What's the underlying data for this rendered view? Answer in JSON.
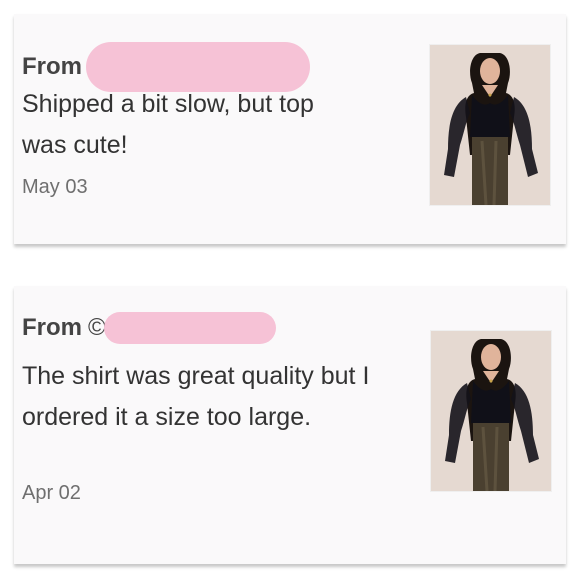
{
  "reviews": [
    {
      "from_label": "From",
      "text": "Shipped a bit slow, but top was cute!",
      "date": "May 03"
    },
    {
      "from_label": "From",
      "handle_prefix": "©",
      "text": "The shirt was great quality but I ordered it a size too large.",
      "date": "Apr 02"
    }
  ],
  "colors": {
    "redaction": "#f6c2d6",
    "card_bg": "#faf9fa",
    "label_text": "#444444",
    "body_text": "#333333",
    "date_text": "#6f6f6f"
  },
  "icons": {
    "product_image": "product-photo-model-black-top"
  }
}
